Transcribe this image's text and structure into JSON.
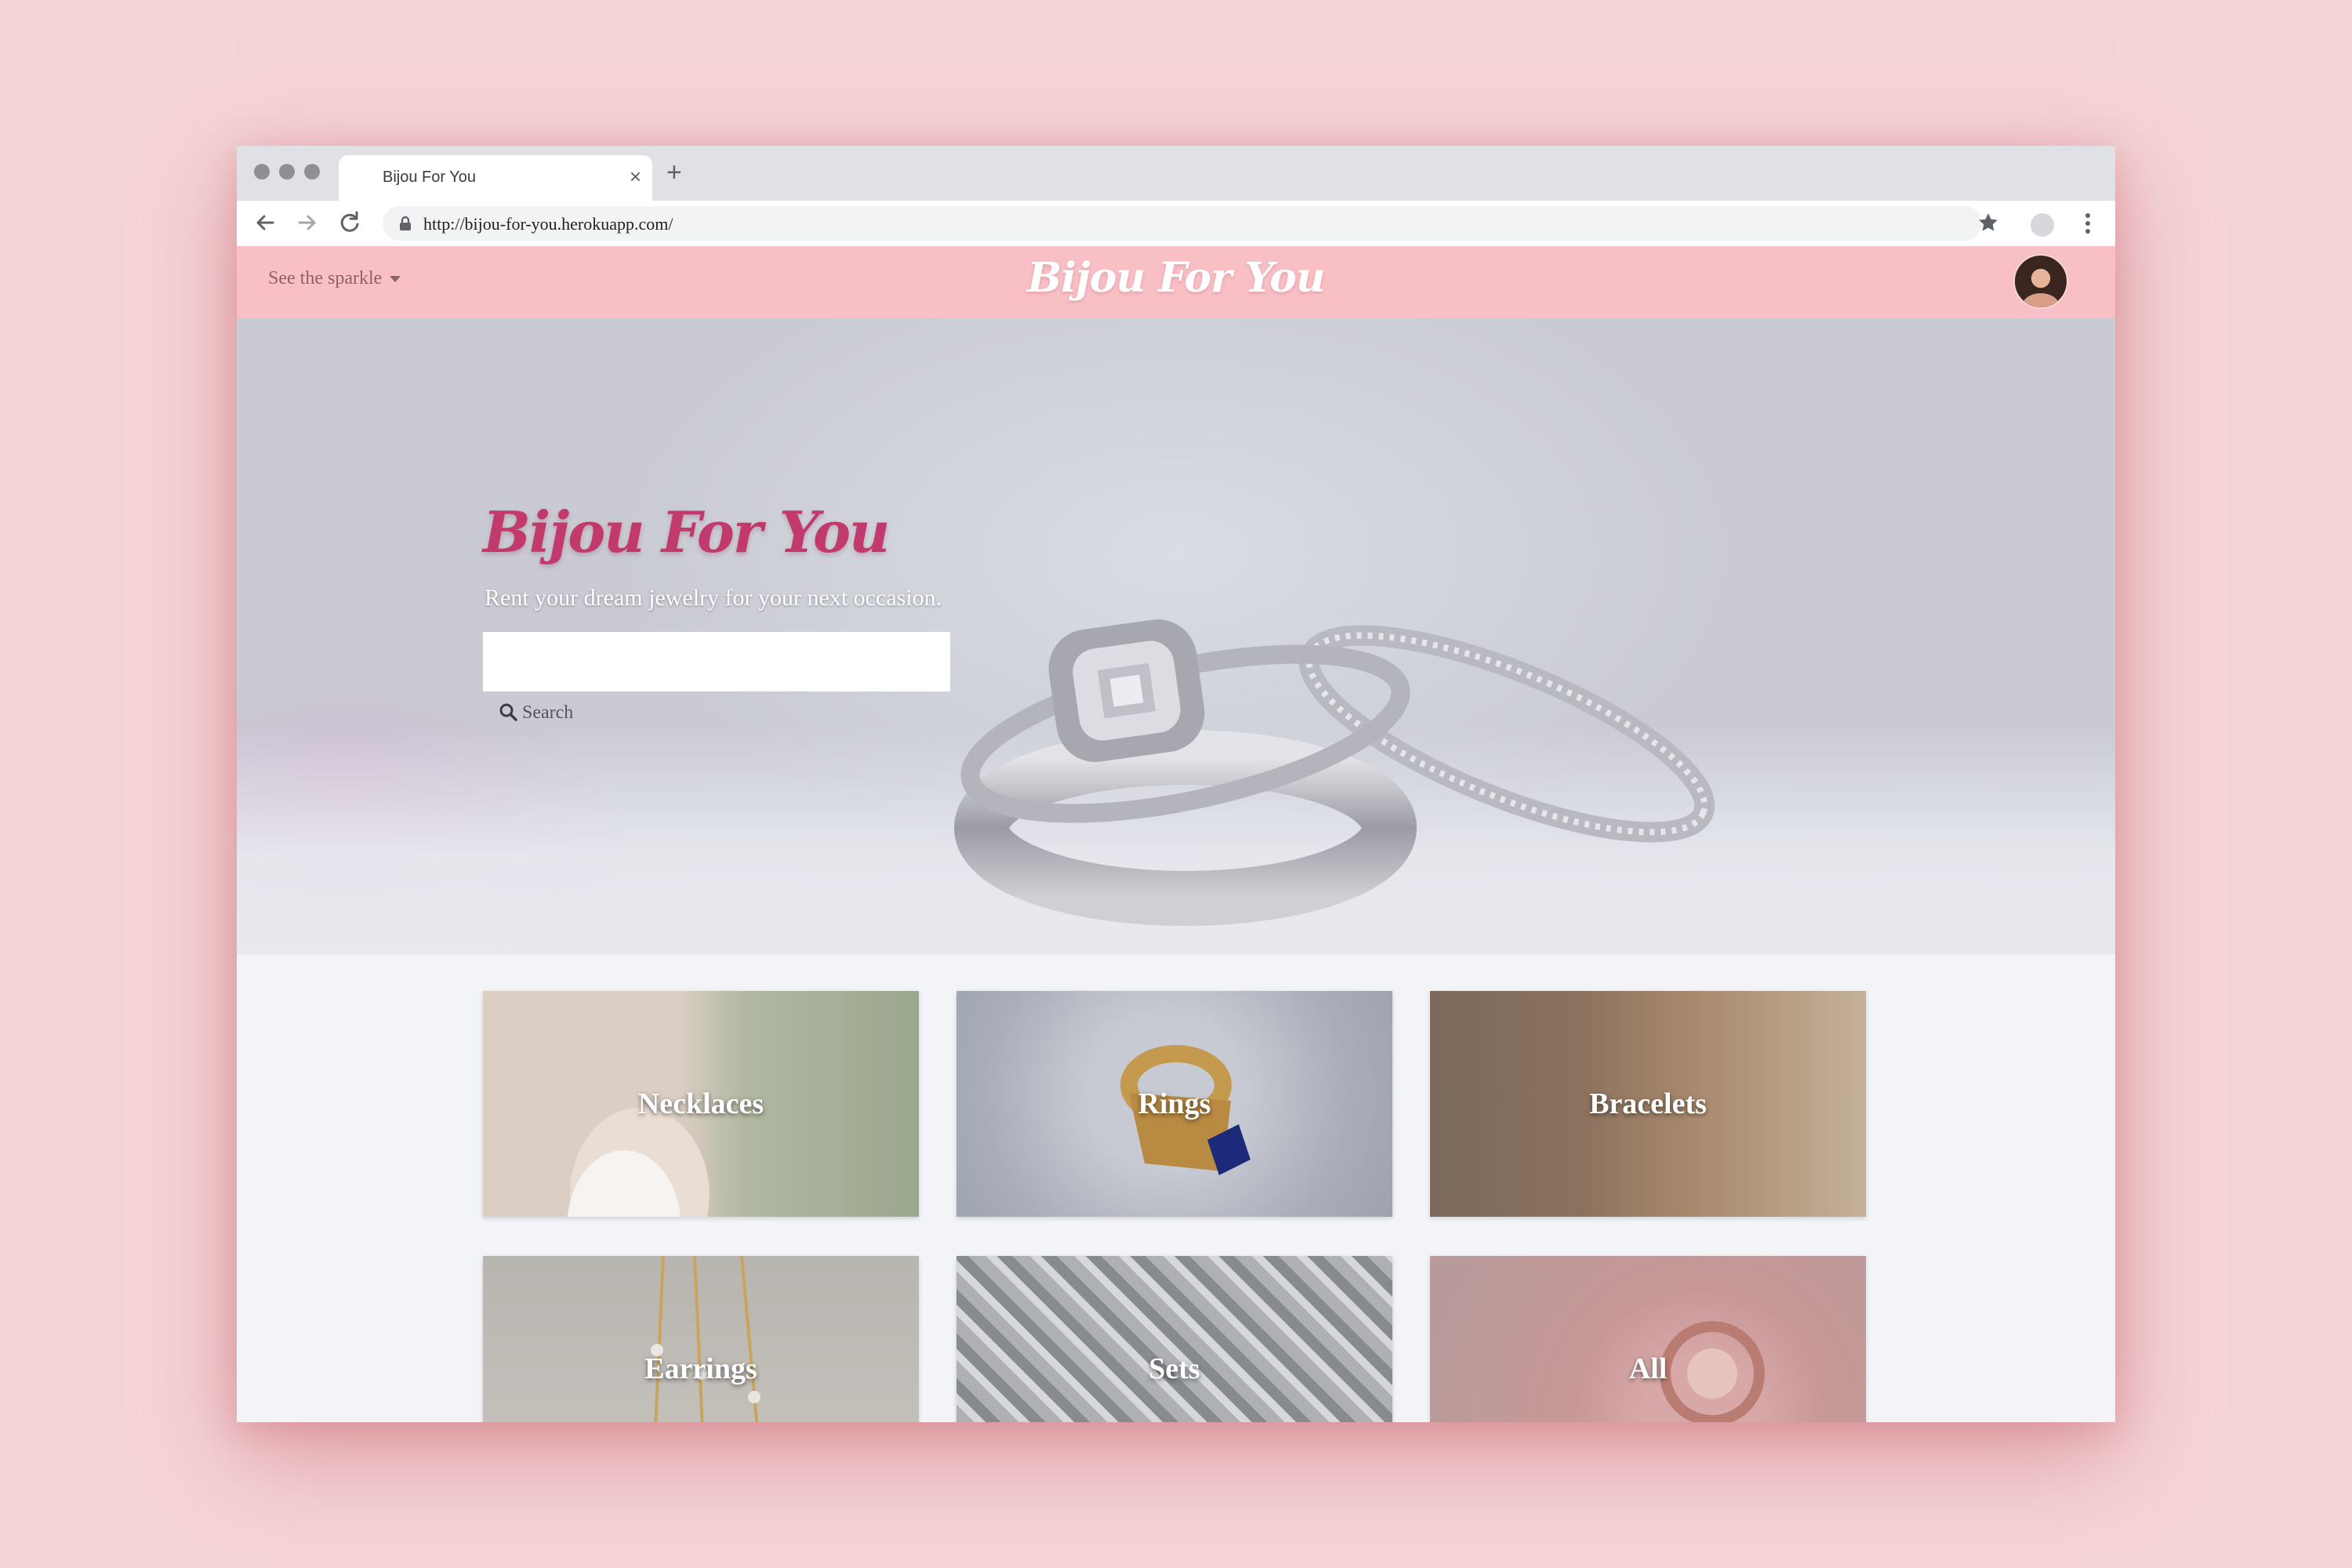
{
  "browser": {
    "tab_title": "Bijou For You",
    "close_glyph": "×",
    "new_tab_glyph": "+",
    "url": "http://bijou-for-you.herokuapp.com/",
    "icons": [
      "back-arrow-icon",
      "forward-arrow-icon",
      "reload-icon",
      "lock-icon",
      "star-icon",
      "kebab-menu-icon"
    ]
  },
  "navbar": {
    "dropdown_label": "See the sparkle",
    "brand": "Bijou For You",
    "background_color": "#f8c0c5"
  },
  "hero": {
    "title": "Bijou For You",
    "subtitle": "Rent your dream jewelry for your next occasion.",
    "search_value": "",
    "search_button": "Search",
    "title_color": "#c23a6c"
  },
  "categories": [
    {
      "label": "Necklaces"
    },
    {
      "label": "Rings"
    },
    {
      "label": "Bracelets"
    },
    {
      "label": "Earrings"
    },
    {
      "label": "Sets"
    },
    {
      "label": "All"
    }
  ],
  "colors": {
    "page_background": "#f5d4d8",
    "content_background": "#f2f4f7"
  }
}
